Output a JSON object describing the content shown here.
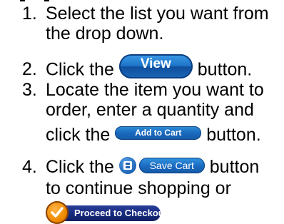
{
  "steps": [
    {
      "number": "1.",
      "lines": [
        "Select the list you want from",
        "the drop down."
      ]
    },
    {
      "number": "2.",
      "before": "Click the",
      "button": "View",
      "after": "button."
    },
    {
      "number": "3.",
      "lines": [
        "Locate the item you want to",
        "order, enter a quantity and"
      ],
      "before": "click the",
      "button": "Add to Cart",
      "after": "button."
    },
    {
      "number": "4.",
      "before": "Click the",
      "button": "Save Cart",
      "after": "button",
      "line2": "to continue shopping or",
      "checkout_button": "Proceed to Checkout"
    }
  ],
  "colors": {
    "button_blue": "#1a69bd",
    "checkout_navy": "#162a7c",
    "checkout_orange": "#f08a00"
  },
  "icons": {
    "save": "floppy-disk-icon",
    "checkout": "checkmark-icon"
  }
}
